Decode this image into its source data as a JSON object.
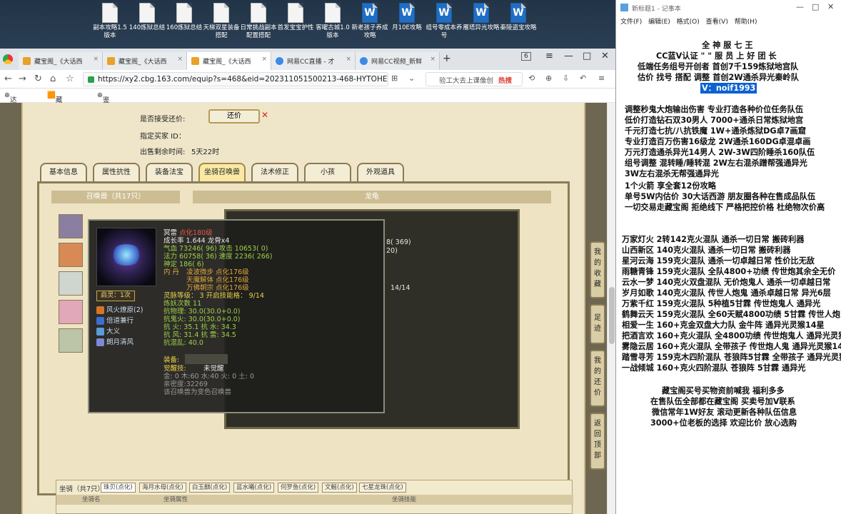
{
  "desktop": {
    "icons": [
      {
        "label": "副本攻略1.5版本",
        "type": "doc"
      },
      {
        "label": "140炼狱总结",
        "type": "doc"
      },
      {
        "label": "160炼狱总结",
        "type": "doc"
      },
      {
        "label": "天梯双星装备搭配",
        "type": "doc"
      },
      {
        "label": "日常挑战副本配置搭配",
        "type": "doc"
      },
      {
        "label": "首发宝宝护性",
        "type": "doc"
      },
      {
        "label": "客曜古城1.0版本",
        "type": "doc"
      },
      {
        "label": "新老孩子养成攻略",
        "type": "word"
      },
      {
        "label": "月10E攻略",
        "type": "word"
      },
      {
        "label": "组号零成本养号",
        "type": "word"
      },
      {
        "label": "雁塔异光攻略",
        "type": "word"
      },
      {
        "label": "秦陵盗宝攻略",
        "type": "word"
      }
    ]
  },
  "browser": {
    "tabs": [
      {
        "label": "藏宝阁_《大话西",
        "active": false
      },
      {
        "label": "藏宝阁_《大话西",
        "active": false
      },
      {
        "label": "藏宝阁_《大话西",
        "active": true
      },
      {
        "label": "网易CC直播 - 才",
        "active": false
      },
      {
        "label": "网易CC视频_新鲜",
        "active": false
      }
    ],
    "tab_count": "6",
    "url": "https://xy2.cbg.163.com/equip?s=468&eid=202311051500213-468-HYTOHENRC2WD&",
    "search_placeholder": "验工大去上课像创",
    "hot_label": "热搜",
    "bookmarks": [
      "达人后台",
      "藏宝阁_大",
      "鉴宝广场"
    ]
  },
  "form": {
    "accept_offer_label": "是否接受还价:",
    "reprice_button": "还价",
    "buyer_id_label": "指定买家 ID：",
    "remaining_label": "出售剩余时间:",
    "remaining_value": "5天22时"
  },
  "page_tabs": [
    "基本信息",
    "属性抗性",
    "装备法宝",
    "坐骑召唤兽",
    "法术修正",
    "小孩",
    "外观道具"
  ],
  "summon_header": "召唤兽（共17只）",
  "right_header": "龙龟",
  "bg_panel": {
    "stat1": "8( 369)",
    "stat2": "20)",
    "stat3": "14/14"
  },
  "tooltip": {
    "name": "冥雷",
    "name_suffix": "点化180级",
    "growth": "成长率 1.644 龙骨x4",
    "hp": "气血 73246( 96) 攻击 10653( 0)",
    "mp": "法力 60758( 36) 速度 2236( 266)",
    "ling": "神定 186( 6)",
    "nei_label": "内  丹",
    "nei1": "凌波微步 点化176级",
    "nei2": "天魔解体 点化176级",
    "nei3": "万佛朝宗 点化176级",
    "jing_button": "启灵：1次",
    "skills": [
      "风火燎原(2)",
      "倍道兼行",
      "大义",
      "朗月清风"
    ],
    "ling_level": "灵脉等级：  3  开启技能格：  9/14",
    "lian": "炼妖次数 11",
    "resist1": "抗物理: 30.0(30.0+0.0)",
    "resist2": "抗鬼火: 30.0(30.0+0.0)",
    "resist3": "抗   火: 35.1 抗   水: 34.3",
    "resist4": "抗   风: 31.4 抗   雷: 34.5",
    "resist5": "抗混乱: 40.0",
    "equip_label": "装备:",
    "awake_label": "觉醒技:",
    "awake_value": "未觉醒",
    "elements": "金: 0 木:60 水:40 火: 0 土: 0",
    "intimacy": "亲密度:32269",
    "note": "该召唤兽为变色召唤兽"
  },
  "bottom": {
    "mount_header": "坐骑（共7只）",
    "tags": [
      "珠贝(点化)",
      "海月水母(点化)",
      "白玉麒(点化)",
      "蓝水曦(点化)",
      "何罗鱼(点化)",
      "文鳐(点化)",
      "七星龙珠(点化)"
    ],
    "col1": "坐骑名",
    "col2": "坐骑属性",
    "col3": "坐骑技能"
  },
  "side_nav": [
    "我的收藏",
    "足迹",
    "我的还价",
    "返回顶部"
  ],
  "notepad": {
    "title": "新标题1 - 记事本",
    "menu": [
      "文件(F)",
      "编辑(E)",
      "格式(O)",
      "查看(V)",
      "帮助(H)"
    ],
    "lines": [
      "全  神  服  七  王",
      "CC蓝V认证 \"  \"  服  员  上  好  团  长",
      "低端任务组号开创者            首创7千159炼狱地宫队",
      "估价 找号 搭配 调整            首创2W通杀异光秦岭队",
      "V：noif1993",
      "调整秒鬼大炮输出伤害          专业打造各种价位任务队伍",
      "低价打造钻石双30男人            7000+通杀日常炼狱地宫",
      "千元打造七抗/八抗铁魔          1W+通杀炼狱DG卓7画窟",
      "专业打造百万伤害16级龙         2W通杀160DG卓混卓画",
      "万元打造通杀异光14男人         2W-3W四阶睡杀160队伍",
      "组号调整 混转睡/睡转混          2W左右混杀蹭帮强通异光",
      "                                3W左右混杀无帮强通异光",
      "1个火箭 享全套12份攻略",
      "单号5W内估价 30大话西游         朋友圈各种在售成品队伍",
      "一切交易走藏宝阁 拒绝线下    严格把控价格 杜绝物次价高",
      "万家灯火 2转142克火混队 通杀一切日常 搬砖利器",
      "山西新区 140克火混队 通杀一切日常 搬砖利器",
      "星河云海 159克火混队 通杀一切卓越日常 性价比无敌",
      "雨糖青锋 159克火混队 全队4800+功绩 传世炮其余全无价",
      "云水一梦 140克火双盘混队 无价炮鬼人 通杀一切卓越日常",
      "岁月如歌 140克火混队 传世人炮鬼 通杀卓越日常 异光6层",
      "万紫千红 159克火混队 5种植5甘霖 传世炮鬼人 通异光",
      "鹤舞云天 159克火混队 全60天赋4800功绩 5甘霖 传世人炮",
      "相爱一生 160+克金双盘大力队 金牛阵 通异光灵猴14星",
      "把酒言欢 160+克火混队 全4800功绩 传世炮鬼人 通异光灵猴",
      "雾隐云居 160+克火混队 全带孩子 传世炮人鬼 通异光灵猴14",
      "踏雪寻芳 159克木四阶混队 苍狼阵5甘霖 全带孩子 通异光灵猴",
      "一战倾城 160+克火四阶混队 苍狼阵 5甘霖 通异光",
      "藏宝阁买号买物资前喊我 福利多多",
      "在售队伍全部都在藏宝阁 买卖号加V联系",
      "微信常年1W好友 滚动更新各种队伍信息",
      "3000+位老板的选择 欢迎比价 放心选购"
    ]
  }
}
